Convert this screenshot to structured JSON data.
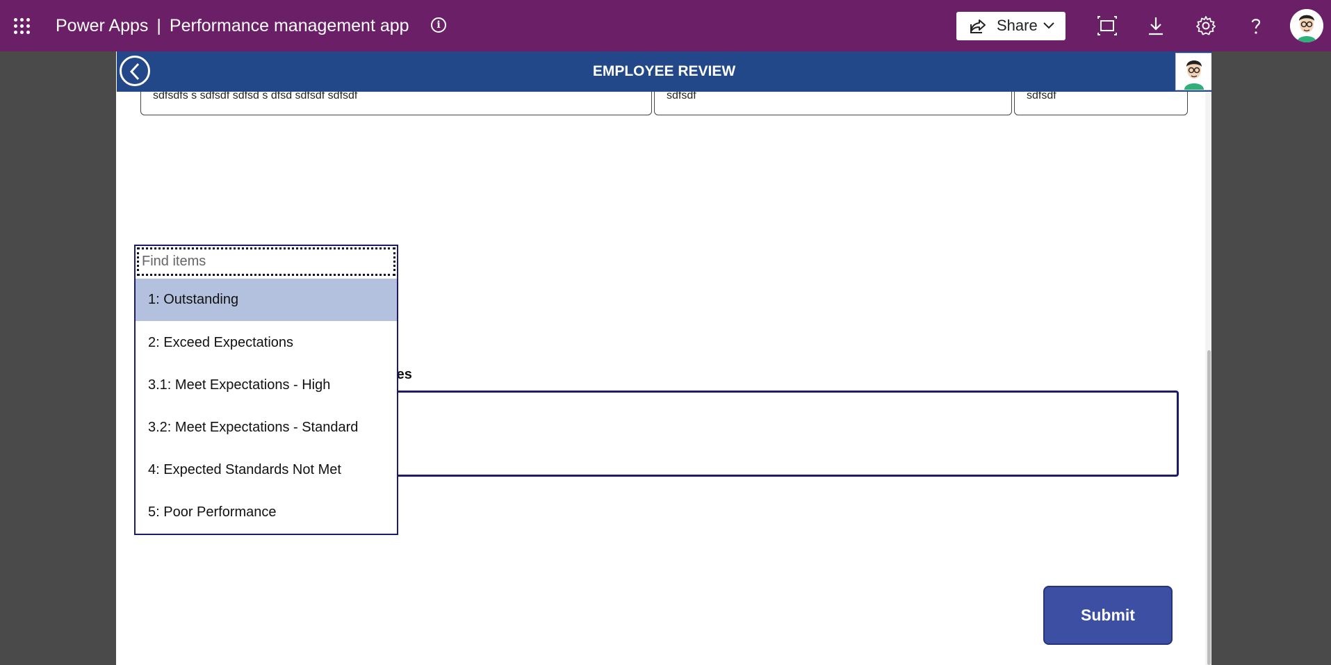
{
  "topbar": {
    "product": "Power Apps",
    "separator": "|",
    "app_name": "Performance management app",
    "share_label": "Share",
    "icons": [
      "waffle-icon",
      "info-icon",
      "share-icon",
      "chevron-down-icon",
      "fit-screen-icon",
      "download-icon",
      "settings-icon",
      "help-icon",
      "avatar"
    ]
  },
  "header": {
    "title": "EMPLOYEE REVIEW"
  },
  "fields": {
    "field1": "sdfsdfs s sdfsdf sdfsd s dfsd sdfsdf sdfsdf",
    "field2": "sdfsdf",
    "field3": "sdfsdf"
  },
  "objectives": {
    "label_visible": "ectives",
    "value": ""
  },
  "dropdown": {
    "search_placeholder": "Find items",
    "options": [
      "1: Outstanding",
      "2: Exceed Expectations",
      "3.1: Meet Expectations - High",
      "3.2: Meet Expectations - Standard",
      "4: Expected Standards Not Met",
      "5: Poor Performance"
    ],
    "selected_index": 0
  },
  "submit_label": "Submit",
  "colors": {
    "topbar": "#6b1f66",
    "header": "#22488a",
    "submit": "#3c4fa3",
    "selected_option": "#b3c1de",
    "dropdown_border": "#1e1a6b"
  }
}
